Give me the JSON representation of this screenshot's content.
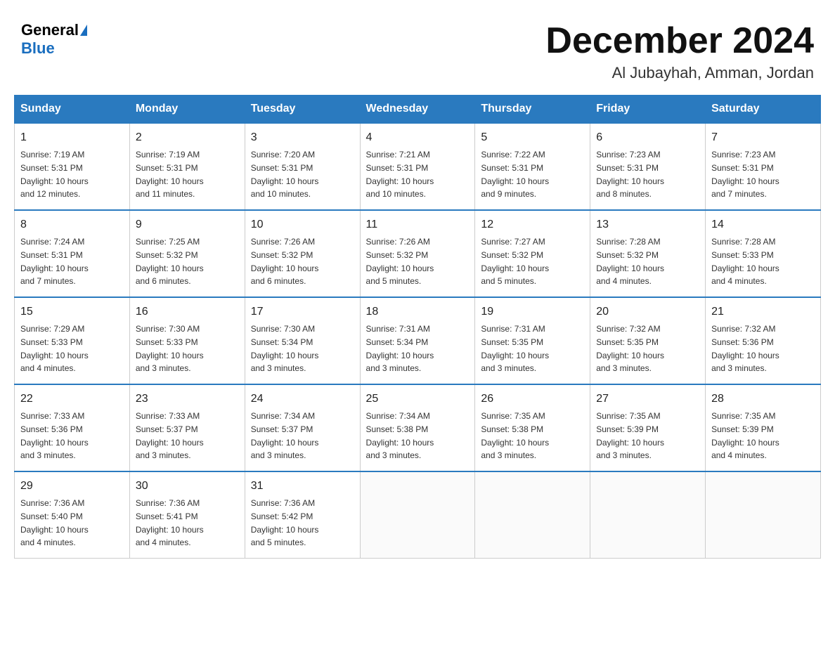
{
  "header": {
    "logo_general": "General",
    "logo_blue": "Blue",
    "title": "December 2024",
    "subtitle": "Al Jubayhah, Amman, Jordan"
  },
  "columns": [
    "Sunday",
    "Monday",
    "Tuesday",
    "Wednesday",
    "Thursday",
    "Friday",
    "Saturday"
  ],
  "weeks": [
    [
      {
        "day": "1",
        "sunrise": "7:19 AM",
        "sunset": "5:31 PM",
        "daylight": "10 hours and 12 minutes."
      },
      {
        "day": "2",
        "sunrise": "7:19 AM",
        "sunset": "5:31 PM",
        "daylight": "10 hours and 11 minutes."
      },
      {
        "day": "3",
        "sunrise": "7:20 AM",
        "sunset": "5:31 PM",
        "daylight": "10 hours and 10 minutes."
      },
      {
        "day": "4",
        "sunrise": "7:21 AM",
        "sunset": "5:31 PM",
        "daylight": "10 hours and 10 minutes."
      },
      {
        "day": "5",
        "sunrise": "7:22 AM",
        "sunset": "5:31 PM",
        "daylight": "10 hours and 9 minutes."
      },
      {
        "day": "6",
        "sunrise": "7:23 AM",
        "sunset": "5:31 PM",
        "daylight": "10 hours and 8 minutes."
      },
      {
        "day": "7",
        "sunrise": "7:23 AM",
        "sunset": "5:31 PM",
        "daylight": "10 hours and 7 minutes."
      }
    ],
    [
      {
        "day": "8",
        "sunrise": "7:24 AM",
        "sunset": "5:31 PM",
        "daylight": "10 hours and 7 minutes."
      },
      {
        "day": "9",
        "sunrise": "7:25 AM",
        "sunset": "5:32 PM",
        "daylight": "10 hours and 6 minutes."
      },
      {
        "day": "10",
        "sunrise": "7:26 AM",
        "sunset": "5:32 PM",
        "daylight": "10 hours and 6 minutes."
      },
      {
        "day": "11",
        "sunrise": "7:26 AM",
        "sunset": "5:32 PM",
        "daylight": "10 hours and 5 minutes."
      },
      {
        "day": "12",
        "sunrise": "7:27 AM",
        "sunset": "5:32 PM",
        "daylight": "10 hours and 5 minutes."
      },
      {
        "day": "13",
        "sunrise": "7:28 AM",
        "sunset": "5:32 PM",
        "daylight": "10 hours and 4 minutes."
      },
      {
        "day": "14",
        "sunrise": "7:28 AM",
        "sunset": "5:33 PM",
        "daylight": "10 hours and 4 minutes."
      }
    ],
    [
      {
        "day": "15",
        "sunrise": "7:29 AM",
        "sunset": "5:33 PM",
        "daylight": "10 hours and 4 minutes."
      },
      {
        "day": "16",
        "sunrise": "7:30 AM",
        "sunset": "5:33 PM",
        "daylight": "10 hours and 3 minutes."
      },
      {
        "day": "17",
        "sunrise": "7:30 AM",
        "sunset": "5:34 PM",
        "daylight": "10 hours and 3 minutes."
      },
      {
        "day": "18",
        "sunrise": "7:31 AM",
        "sunset": "5:34 PM",
        "daylight": "10 hours and 3 minutes."
      },
      {
        "day": "19",
        "sunrise": "7:31 AM",
        "sunset": "5:35 PM",
        "daylight": "10 hours and 3 minutes."
      },
      {
        "day": "20",
        "sunrise": "7:32 AM",
        "sunset": "5:35 PM",
        "daylight": "10 hours and 3 minutes."
      },
      {
        "day": "21",
        "sunrise": "7:32 AM",
        "sunset": "5:36 PM",
        "daylight": "10 hours and 3 minutes."
      }
    ],
    [
      {
        "day": "22",
        "sunrise": "7:33 AM",
        "sunset": "5:36 PM",
        "daylight": "10 hours and 3 minutes."
      },
      {
        "day": "23",
        "sunrise": "7:33 AM",
        "sunset": "5:37 PM",
        "daylight": "10 hours and 3 minutes."
      },
      {
        "day": "24",
        "sunrise": "7:34 AM",
        "sunset": "5:37 PM",
        "daylight": "10 hours and 3 minutes."
      },
      {
        "day": "25",
        "sunrise": "7:34 AM",
        "sunset": "5:38 PM",
        "daylight": "10 hours and 3 minutes."
      },
      {
        "day": "26",
        "sunrise": "7:35 AM",
        "sunset": "5:38 PM",
        "daylight": "10 hours and 3 minutes."
      },
      {
        "day": "27",
        "sunrise": "7:35 AM",
        "sunset": "5:39 PM",
        "daylight": "10 hours and 3 minutes."
      },
      {
        "day": "28",
        "sunrise": "7:35 AM",
        "sunset": "5:39 PM",
        "daylight": "10 hours and 4 minutes."
      }
    ],
    [
      {
        "day": "29",
        "sunrise": "7:36 AM",
        "sunset": "5:40 PM",
        "daylight": "10 hours and 4 minutes."
      },
      {
        "day": "30",
        "sunrise": "7:36 AM",
        "sunset": "5:41 PM",
        "daylight": "10 hours and 4 minutes."
      },
      {
        "day": "31",
        "sunrise": "7:36 AM",
        "sunset": "5:42 PM",
        "daylight": "10 hours and 5 minutes."
      },
      null,
      null,
      null,
      null
    ]
  ],
  "labels": {
    "sunrise": "Sunrise:",
    "sunset": "Sunset:",
    "daylight": "Daylight:"
  }
}
